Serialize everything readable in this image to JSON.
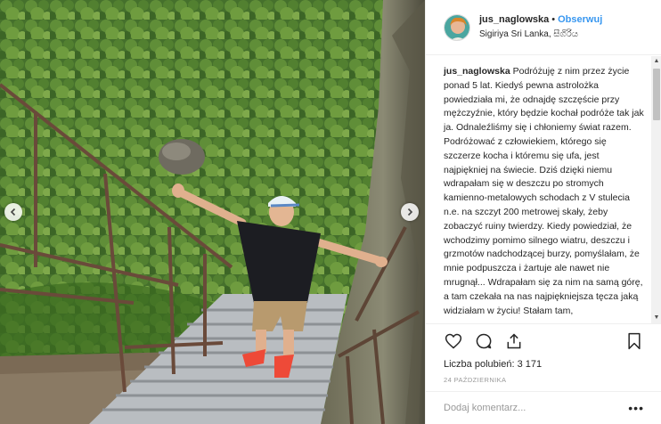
{
  "post": {
    "username": "jus_naglowska",
    "separator": "•",
    "follow_label": "Obserwuj",
    "location": "Sigiriya Sri Lanka, සීගිරිය"
  },
  "caption": {
    "author": "jus_naglowska",
    "text": " Podróżuję z nim przez życie ponad 5 lat. Kiedyś pewna astrolożka powiedziała mi, że odnajdę szczęście przy mężczyźnie, który będzie kochał podróże tak jak ja. Odnaleźliśmy się i chłoniemy świat razem. Podróżować z człowiekiem, którego się szczerze kocha i któremu się ufa, jest najpiękniej na świecie. Dziś dzięki niemu wdrapałam się w deszczu po stromych kamienno-metalowych schodach z V stulecia n.e. na szczyt 200 metrowej skały, żeby zobaczyć ruiny twierdzy. Kiedy powiedział, że wchodzimy pomimo silnego wiatru, deszczu i grzmotów nadchodzącej burzy, pomyślałam, że mnie podpuszcza i żartuje ale nawet nie mrugnął... Wdrapałam się za nim na samą górę, a tam czekała na nas najpiękniejsza tęcza jaką widziałam w życiu! Stałam tam,"
  },
  "engagement": {
    "likes_label": "Liczba polubień:",
    "likes_count": "3 171",
    "date": "24 PAŹDZIERNIKA"
  },
  "comment": {
    "placeholder": "Dodaj komentarz...",
    "more_label": "•••"
  },
  "icons": {
    "like": "heart-icon",
    "comment": "comment-icon",
    "share": "share-icon",
    "save": "bookmark-icon",
    "prev": "chevron-left-icon",
    "next": "chevron-right-icon"
  },
  "colors": {
    "follow": "#3897f0",
    "text": "#262626",
    "muted": "#999999",
    "border": "#efefef"
  }
}
